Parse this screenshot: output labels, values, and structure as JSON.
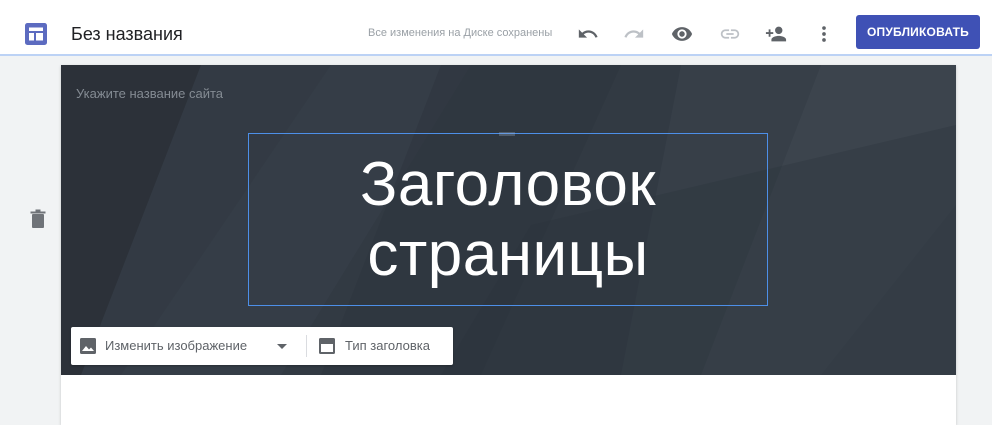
{
  "app": {
    "logo_icon": "sites-layout-icon",
    "title": "Без названия",
    "save_status": "Все изменения на Диске сохранены"
  },
  "toolbar": {
    "icons": [
      "undo-icon",
      "redo-icon",
      "preview-icon",
      "link-icon",
      "share-icon",
      "more-vert-icon"
    ],
    "publish_label": "ОПУБЛИКОВАТЬ"
  },
  "editor": {
    "delete_icon": "trash-icon"
  },
  "header": {
    "site_name_placeholder": "Укажите название сайта",
    "title_lines": [
      "Заголовок",
      "страницы"
    ],
    "change_image_label": "Изменить изображение",
    "header_type_label": "Тип заголовка"
  },
  "colors": {
    "accent": "#3f51b5",
    "selection": "#4d8fe8",
    "header_bg": "#323a43",
    "app_icon": "#5c6bc0"
  }
}
